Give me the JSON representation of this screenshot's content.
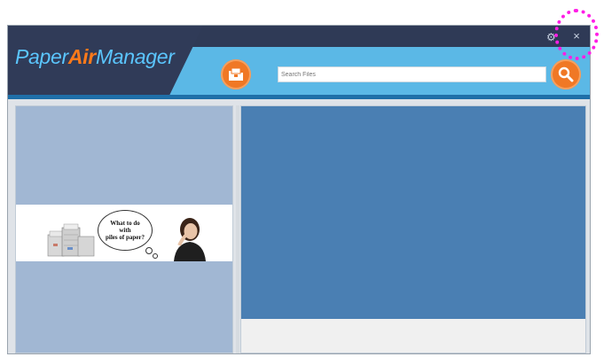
{
  "app": {
    "logo_part1": "Paper",
    "logo_part2": "Air",
    "logo_part3": "Manager"
  },
  "toolbar": {
    "search_placeholder": "Search Files"
  },
  "window_controls": {
    "settings_icon": "gear-icon",
    "close_label": "×"
  },
  "banner": {
    "bubble_line1": "What to do",
    "bubble_line2": "with",
    "bubble_line3": "piles of paper?"
  },
  "colors": {
    "header_dark": "#303b58",
    "header_light": "#5bb8e6",
    "accent_orange": "#f07825",
    "left_panel": "#a1b7d3",
    "preview_panel": "#4a7fb3",
    "highlight": "#ff1ee6"
  }
}
